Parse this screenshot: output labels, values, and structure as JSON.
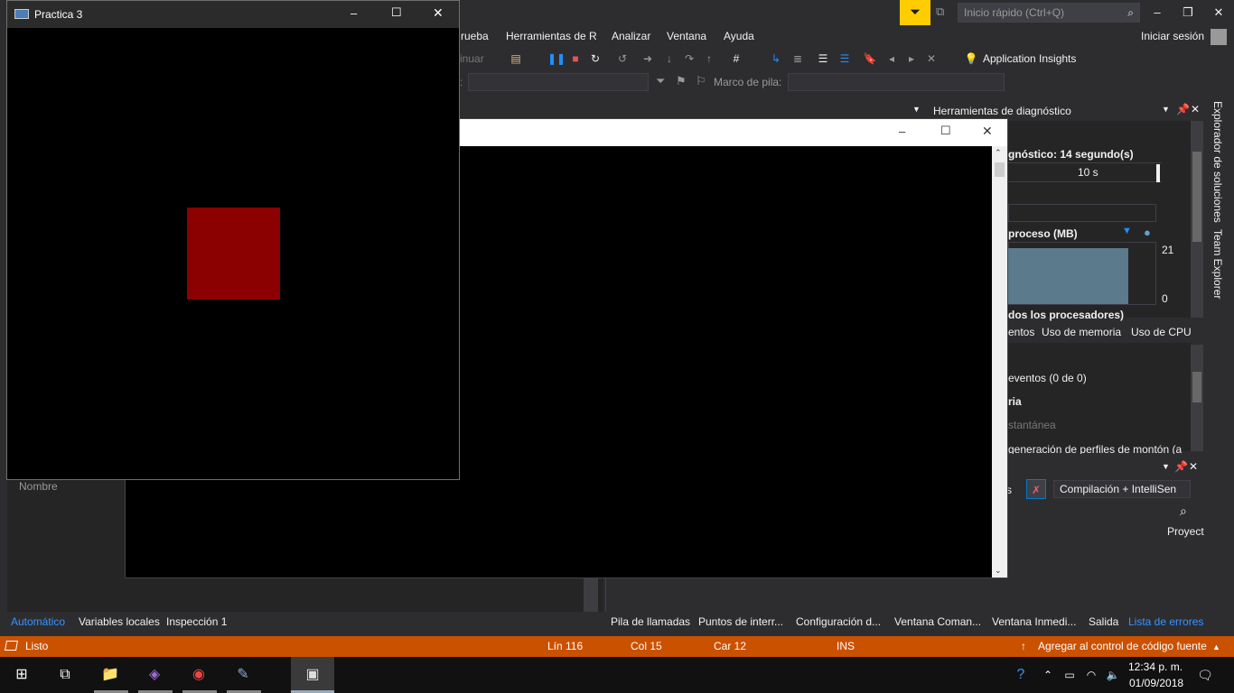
{
  "vs": {
    "quick_launch_placeholder": "Inicio rápido (Ctrl+Q)",
    "signin": "Iniciar sesión",
    "menu": [
      "rueba",
      "Herramientas de R",
      "Analizar",
      "Ventana",
      "Ayuda"
    ],
    "toolbar": {
      "continue_fragment": "inuar",
      "application_insights": "Application Insights",
      "stack_frame_label": "Marco de pila:",
      "colon_fragment": ":"
    }
  },
  "diagnostics": {
    "title": "Herramientas de diagnóstico",
    "session": "gnóstico: 14 segundo(s)",
    "ruler_label": "10 s",
    "memory_label": "proceso (MB)",
    "memory_max": "21",
    "memory_min": "0",
    "cpu_label": "dos los procesadores)",
    "tabs": [
      "entos",
      "Uso de memoria",
      "Uso de CPU"
    ],
    "events": "eventos (0 de 0)",
    "section": "ria",
    "snapshot": "stantánea",
    "profiling": "generación de perfiles de montón (a"
  },
  "side_tabs": [
    "Explorador de soluciones",
    "Team Explorer"
  ],
  "error_list": {
    "fragment": "s",
    "build_combo": "Compilación + IntelliSen",
    "project_col": "Proyect"
  },
  "locals": {
    "name_col": "Nombre"
  },
  "bottom_tabs_left": [
    "Automático",
    "Variables locales",
    "Inspección 1"
  ],
  "bottom_tabs_right": [
    "Pila de llamadas",
    "Puntos de interr...",
    "Configuración d...",
    "Ventana Coman...",
    "Ventana Inmedi...",
    "Salida",
    "Lista de errores"
  ],
  "status": {
    "ready": "Listo",
    "line": "Lín 116",
    "col": "Col 15",
    "car": "Car 12",
    "ins": "INS",
    "source_control": "Agregar al control de código fuente"
  },
  "taskbar": {
    "time": "12:34 p. m.",
    "date": "01/09/2018"
  },
  "practica": {
    "title": "Practica 3",
    "square_color": "#8b0000"
  }
}
